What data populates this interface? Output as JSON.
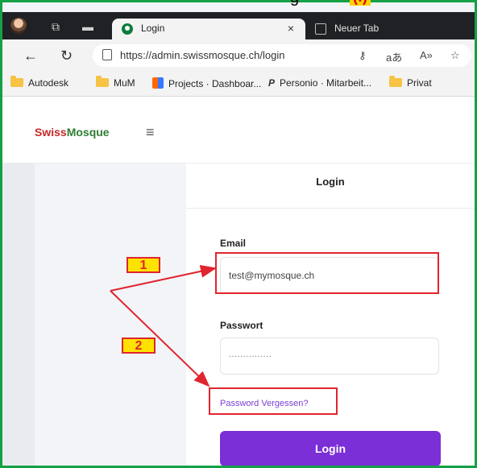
{
  "caption": {
    "text": "g",
    "badge": "(!)"
  },
  "browser": {
    "tab_active_title": "Login",
    "tab_close": "×",
    "tab_inactive_title": "Neuer Tab",
    "url": "https://admin.swissmosque.ch/login",
    "bookmarks": [
      {
        "label": "Autodesk",
        "icon": "folder-icon"
      },
      {
        "label": "MuM",
        "icon": "folder-icon"
      },
      {
        "label": "Projects · Dashboar...",
        "icon": "projects-icon"
      },
      {
        "label": "Personio · Mitarbeit...",
        "icon": "personio-icon"
      },
      {
        "label": "Privat",
        "icon": "folder-icon"
      }
    ]
  },
  "app": {
    "logo_a": "Swiss",
    "logo_b": "Mosque",
    "menu_icon": "≡"
  },
  "form": {
    "title": "Login",
    "email_label": "Email",
    "email_value": "test@mymosque.ch",
    "password_label": "Passwort",
    "password_mask": "...............",
    "forgot_link": "Password Vergessen?",
    "submit": "Login"
  },
  "annotations": {
    "tag1": "1",
    "tag2": "2"
  },
  "colors": {
    "accent": "#7b2fd6",
    "frame": "#15a046",
    "annotation": "#e0252e"
  }
}
